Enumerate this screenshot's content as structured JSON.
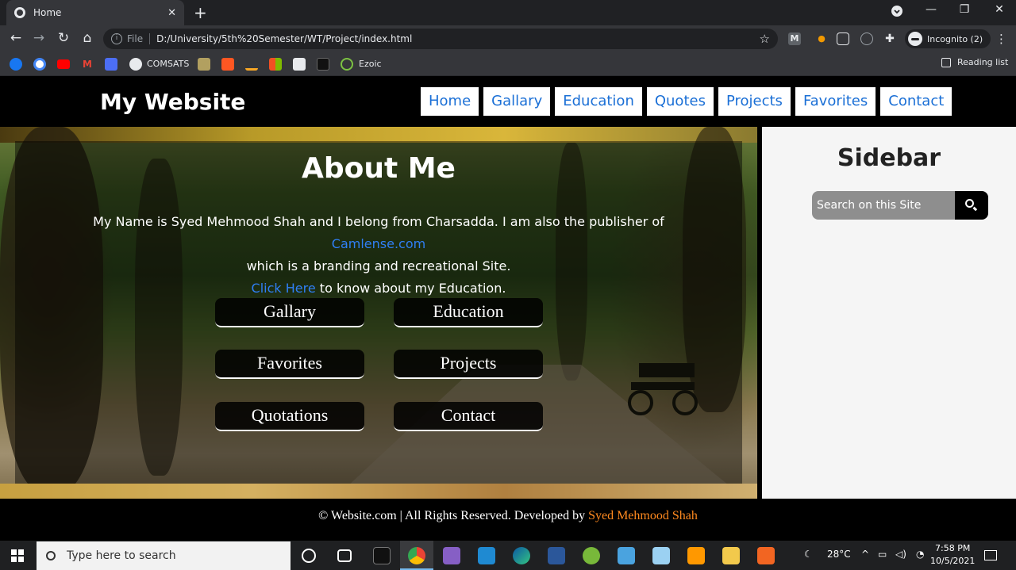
{
  "browser": {
    "tab_title": "Home",
    "tab_close": "✕",
    "new_tab": "+",
    "window_controls": {
      "minimize": "—",
      "restore": "❐",
      "close": "✕"
    },
    "omnibox": {
      "scheme_label": "File",
      "url": "D:/University/5th%20Semester/WT/Project/index.html"
    },
    "incognito_label": "Incognito (2)",
    "bookmarks": [
      {
        "label": "COMSATS"
      },
      {
        "label": "Ezoic"
      }
    ],
    "reading_list": "Reading list"
  },
  "site": {
    "logo": "My Website",
    "nav": [
      "Home",
      "Gallary",
      "Education",
      "Quotes",
      "Projects",
      "Favorites",
      "Contact"
    ],
    "hero": {
      "title": "About Me",
      "text_part1": "My Name is Syed Mehmood Shah and I belong from Charsadda. I am also the publisher of ",
      "link1": "Camlense.com",
      "text_part2": " which is a branding and recreational Site.",
      "link2": "Click Here",
      "text_part3": " to know about my Education.",
      "buttons": [
        "Gallary",
        "Education",
        "Favorites",
        "Projects",
        "Quotations",
        "Contact"
      ]
    },
    "sidebar": {
      "title": "Sidebar",
      "search_placeholder": "Search on this Site"
    },
    "footer": {
      "text": "© Website.com | All Rights Reserved. Developed by ",
      "developer": "Syed Mehmood Shah"
    }
  },
  "taskbar": {
    "search_placeholder": "Type here to search",
    "temperature": "28°C",
    "time": "7:58 PM",
    "date": "10/5/2021"
  },
  "colors": {
    "link_blue": "#1a6fd6",
    "footer_accent": "#ff8a1f",
    "header_bg": "#000000",
    "sidebar_bg": "#f5f5f5"
  }
}
